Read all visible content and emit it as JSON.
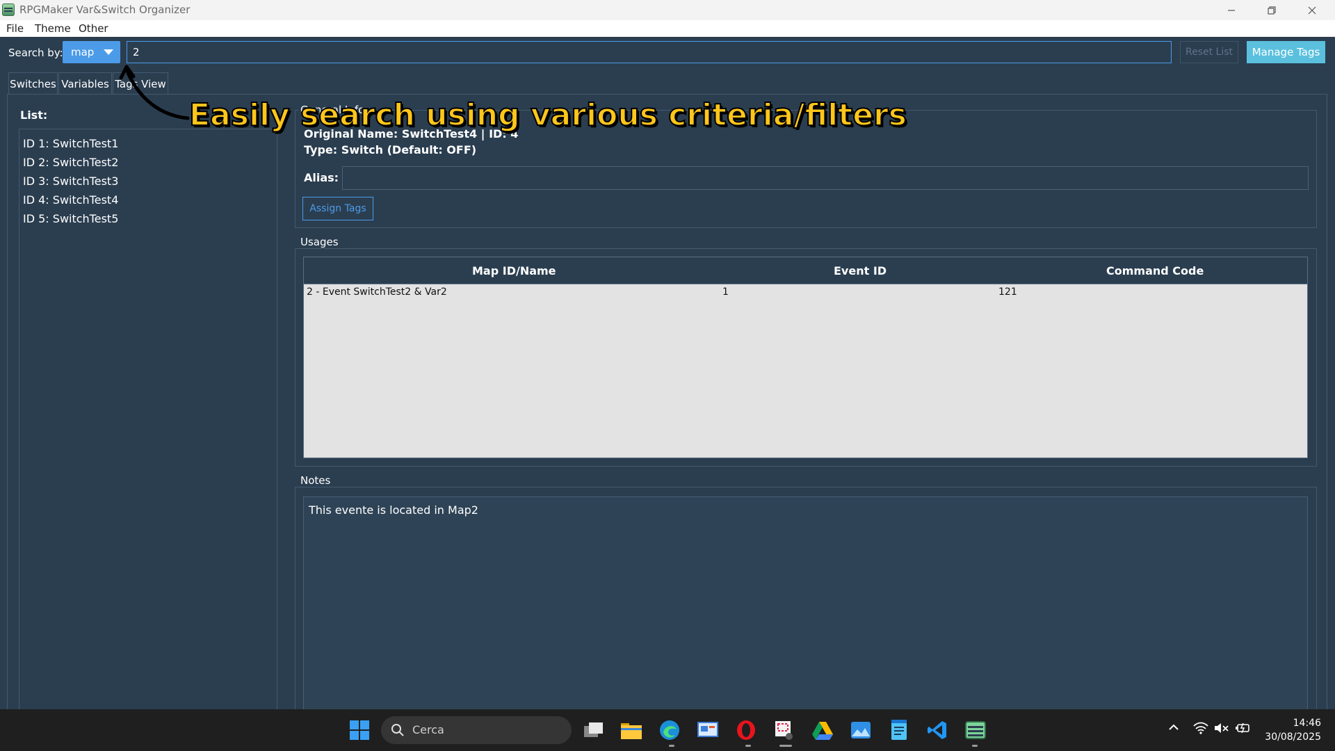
{
  "window": {
    "title": "RPGMaker Var&Switch Organizer"
  },
  "menu": {
    "items": [
      "File",
      "Theme",
      "Other"
    ]
  },
  "search": {
    "label": "Search by:",
    "mode": "map",
    "value": "2",
    "reset_label": "Reset List",
    "manage_label": "Manage Tags"
  },
  "tabs": [
    "Switches",
    "Variables",
    "Tags View"
  ],
  "list": {
    "label": "List:",
    "items": [
      "ID 1: SwitchTest1",
      "ID 2: SwitchTest2",
      "ID 3: SwitchTest3",
      "ID 4: SwitchTest4",
      "ID 5: SwitchTest5"
    ]
  },
  "info": {
    "title": "General Info",
    "original_name": "Original Name: SwitchTest4 | ID: 4",
    "type": "Type: Switch (Default: OFF)",
    "alias_label": "Alias:",
    "assign_label": "Assign Tags"
  },
  "usages": {
    "title": "Usages",
    "headers": [
      "Map ID/Name",
      "Event ID",
      "Command Code"
    ],
    "rows": [
      [
        "2 - Event SwitchTest2 & Var2",
        "1",
        "121"
      ]
    ]
  },
  "notes": {
    "title": "Notes",
    "text": "This evente is located in Map2"
  },
  "annotation": "Easily search using various criteria/filters",
  "taskbar": {
    "search_placeholder": "Cerca",
    "time": "14:46",
    "date": "30/08/2025"
  },
  "colors": {
    "background": "#2b3e50",
    "accent": "#4c9be8",
    "info": "#5bc0de",
    "annotation": "#ffc61a"
  }
}
